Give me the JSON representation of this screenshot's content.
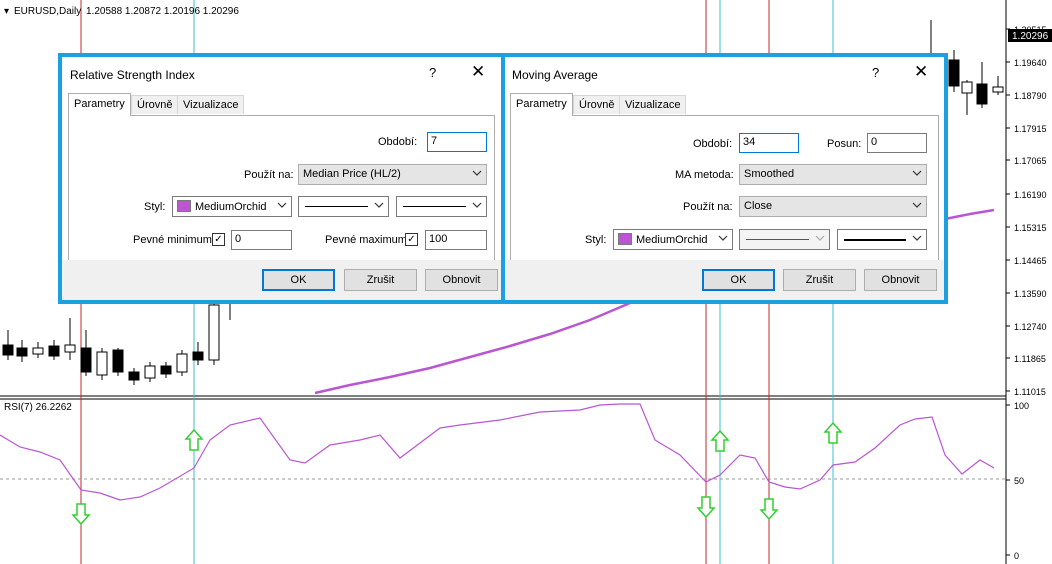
{
  "chart": {
    "symbol_header": "EURUSD,Daily",
    "ohlc_values": "1.20588 1.20872 1.20196 1.20296",
    "price_ticks": [
      "1.20515",
      "1.19640",
      "1.18790",
      "1.17915",
      "1.17065",
      "1.16190",
      "1.15315",
      "1.14465",
      "1.13590",
      "1.12740",
      "1.11865",
      "1.11015"
    ],
    "current_price": "1.20296",
    "rsi_label": "RSI(7) 26.2262",
    "rsi_ticks": [
      "100",
      "50",
      "0"
    ],
    "ma_color": "#ba55d3",
    "rsi_color": "#ba55d3",
    "arrow_color": "#32cd32"
  },
  "rsi_dialog": {
    "title": "Relative Strength Index",
    "help_label": "?",
    "close_label": "✕",
    "tabs": [
      "Parametry",
      "Úrovně",
      "Vizualizace"
    ],
    "period_label": "Období:",
    "period_value": "7",
    "apply_label": "Použít na:",
    "apply_value": "Median Price (HL/2)",
    "style_label": "Styl:",
    "style_color": "MediumOrchid",
    "fixed_min_label": "Pevné minimum",
    "fixed_min_value": "0",
    "fixed_max_label": "Pevné maximum",
    "fixed_max_value": "100",
    "ok": "OK",
    "cancel": "Zrušit",
    "reset": "Obnovit"
  },
  "ma_dialog": {
    "title": "Moving Average",
    "help_label": "?",
    "close_label": "✕",
    "tabs": [
      "Parametry",
      "Úrovně",
      "Vizualizace"
    ],
    "period_label": "Období:",
    "period_value": "34",
    "shift_label": "Posun:",
    "shift_value": "0",
    "method_label": "MA metoda:",
    "method_value": "Smoothed",
    "apply_label": "Použít na:",
    "apply_value": "Close",
    "style_label": "Styl:",
    "style_color": "MediumOrchid",
    "ok": "OK",
    "cancel": "Zrušit",
    "reset": "Obnovit"
  }
}
